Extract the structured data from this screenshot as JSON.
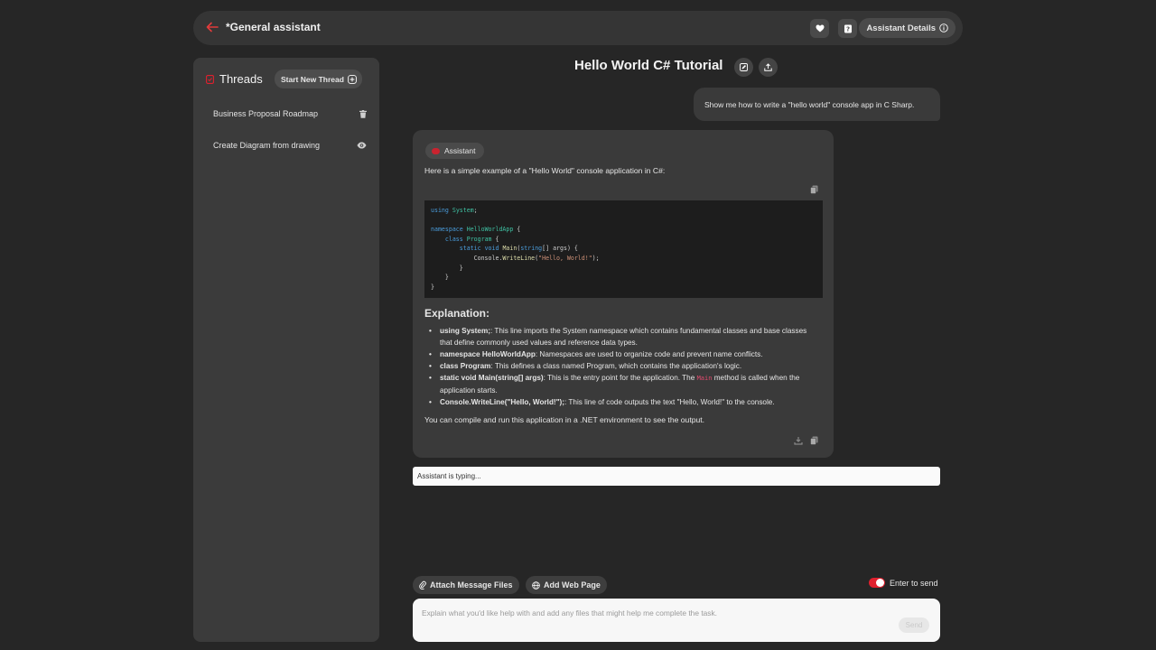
{
  "header": {
    "title": "*General assistant",
    "details_label": "Assistant Details"
  },
  "sidebar": {
    "title": "Threads",
    "new_thread_label": "Start New Thread",
    "threads": [
      {
        "label": "Business Proposal Roadmap",
        "icon": "trash-icon"
      },
      {
        "label": "Create Diagram from drawing",
        "icon": "eye-icon"
      }
    ]
  },
  "conversation": {
    "title": "Hello World C# Tutorial",
    "user_message": "Show me how to write a \"hello world\" console app in C Sharp.",
    "assistant": {
      "badge": "Assistant",
      "intro": "Here is a simple example of a \"Hello World\" console application in C#:",
      "code": {
        "l1a": "using",
        "l1b": "System",
        "l3a": "namespace",
        "l3b": "HelloWorldApp",
        "l4a": "class",
        "l4b": "Program",
        "l5a": "static",
        "l5b": "void",
        "l5c": "Main",
        "l5d": "string",
        "l5e": "[] args) {",
        "l6a": "Console.",
        "l6b": "WriteLine",
        "l6c": "\"Hello, World!\""
      },
      "explanation_heading": "Explanation:",
      "bullets": [
        {
          "bold": "using System;",
          "text": ": This line imports the System namespace which contains fundamental classes and base classes that define commonly used values and reference data types."
        },
        {
          "bold": "namespace HelloWorldApp",
          "text": ": Namespaces are used to organize code and prevent name conflicts."
        },
        {
          "bold": "class Program",
          "text": ": This defines a class named Program, which contains the application's logic."
        },
        {
          "bold": "static void Main(string[] args)",
          "text_before": ": This is the entry point for the application. The ",
          "inline_code": "Main",
          "text_after": " method is called when the application starts."
        },
        {
          "bold": "Console.WriteLine(\"Hello, World!\");",
          "text": ": This line of code outputs the text \"Hello, World!\" to the console."
        }
      ],
      "outro": "You can compile and run this application in a .NET environment to see the output."
    },
    "typing_status": "Assistant is typing..."
  },
  "composer": {
    "attach_label": "Attach Message Files",
    "web_label": "Add Web Page",
    "enter_to_send_label": "Enter to send",
    "enter_to_send": true,
    "placeholder": "Explain what you'd like help with and add any files that might help me complete the task.",
    "send_label": "Send"
  },
  "colors": {
    "accent": "#e0202e",
    "background": "#262626",
    "panel": "#3b3b3b"
  }
}
